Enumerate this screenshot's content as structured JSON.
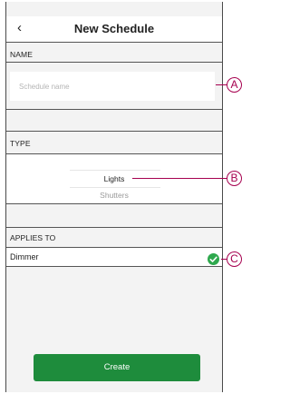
{
  "header": {
    "back_icon": "‹",
    "title": "New Schedule"
  },
  "name_section": {
    "label": "NAME",
    "placeholder": "Schedule name",
    "value": ""
  },
  "type_section": {
    "label": "TYPE",
    "options": [
      {
        "label": "Lights",
        "selected": true
      },
      {
        "label": "Shutters",
        "selected": false
      }
    ]
  },
  "applies_section": {
    "label": "APPLIES TO",
    "items": [
      {
        "label": "Dimmer",
        "checked": true
      }
    ]
  },
  "create_button": {
    "label": "Create"
  },
  "callouts": [
    "A",
    "B",
    "C"
  ],
  "colors": {
    "accent_green": "#1e8c3c",
    "check_green": "#2ea84d",
    "callout": "#a6004f",
    "background": "#f3f3f3"
  }
}
